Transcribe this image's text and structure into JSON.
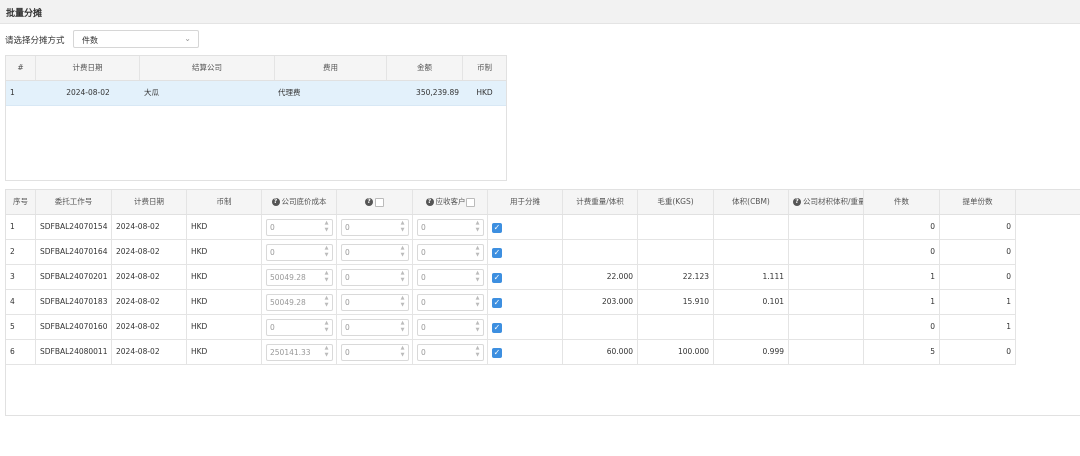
{
  "page": {
    "title": "批量分摊"
  },
  "method": {
    "label": "请选择分摊方式",
    "value": "件数"
  },
  "fee_table": {
    "headers": [
      "#",
      "计费日期",
      "结算公司",
      "费用",
      "金额",
      "币制"
    ],
    "rows": [
      {
        "idx": "1",
        "date": "2024-08-02",
        "company": "大瓜",
        "fee": "代理费",
        "amount": "350,239.89",
        "currency": "HKD"
      }
    ]
  },
  "alloc_table": {
    "headers": {
      "seq": "序号",
      "job": "委托工作号",
      "date": "计费日期",
      "currency": "币制",
      "base_cost": "公司底价成本",
      "col6": "",
      "receivable": "应收客户",
      "use_alloc": "用于分摊",
      "charge_weight": "计费重量/体积",
      "gross": "毛重(KGS)",
      "volume": "体积(CBM)",
      "company_vol": "公司材积体积/重量",
      "pieces": "件数",
      "bills": "提单份数"
    },
    "rows": [
      {
        "seq": "1",
        "job": "SDFBAL24070154",
        "date": "2024-08-02",
        "currency": "HKD",
        "base_cost": "0",
        "v6": "0",
        "receivable": "0",
        "use": true,
        "charge_weight": "",
        "gross": "",
        "volume": "",
        "company_vol": "",
        "pieces": "0",
        "bills": "0"
      },
      {
        "seq": "2",
        "job": "SDFBAL24070164",
        "date": "2024-08-02",
        "currency": "HKD",
        "base_cost": "0",
        "v6": "0",
        "receivable": "0",
        "use": true,
        "charge_weight": "",
        "gross": "",
        "volume": "",
        "company_vol": "",
        "pieces": "0",
        "bills": "0"
      },
      {
        "seq": "3",
        "job": "SDFBAL24070201",
        "date": "2024-08-02",
        "currency": "HKD",
        "base_cost": "50049.28",
        "v6": "0",
        "receivable": "0",
        "use": true,
        "charge_weight": "22.000",
        "gross": "22.123",
        "volume": "1.111",
        "company_vol": "",
        "pieces": "1",
        "bills": "0"
      },
      {
        "seq": "4",
        "job": "SDFBAL24070183",
        "date": "2024-08-02",
        "currency": "HKD",
        "base_cost": "50049.28",
        "v6": "0",
        "receivable": "0",
        "use": true,
        "charge_weight": "203.000",
        "gross": "15.910",
        "volume": "0.101",
        "company_vol": "",
        "pieces": "1",
        "bills": "1"
      },
      {
        "seq": "5",
        "job": "SDFBAL24070160",
        "date": "2024-08-02",
        "currency": "HKD",
        "base_cost": "0",
        "v6": "0",
        "receivable": "0",
        "use": true,
        "charge_weight": "",
        "gross": "",
        "volume": "",
        "company_vol": "",
        "pieces": "0",
        "bills": "1"
      },
      {
        "seq": "6",
        "job": "SDFBAL24080011",
        "date": "2024-08-02",
        "currency": "HKD",
        "base_cost": "250141.33",
        "v6": "0",
        "receivable": "0",
        "use": true,
        "charge_weight": "60.000",
        "gross": "100.000",
        "volume": "0.999",
        "company_vol": "",
        "pieces": "5",
        "bills": "0"
      }
    ]
  },
  "colors": {
    "selected_row": "#e3f1fb",
    "checkbox": "#3d8fe0",
    "header_bg": "#f5f5f5"
  },
  "icons": {
    "info": "info-circle-icon",
    "dropdown": "chevron-down-icon",
    "spinner": "spinner-arrows-icon"
  }
}
